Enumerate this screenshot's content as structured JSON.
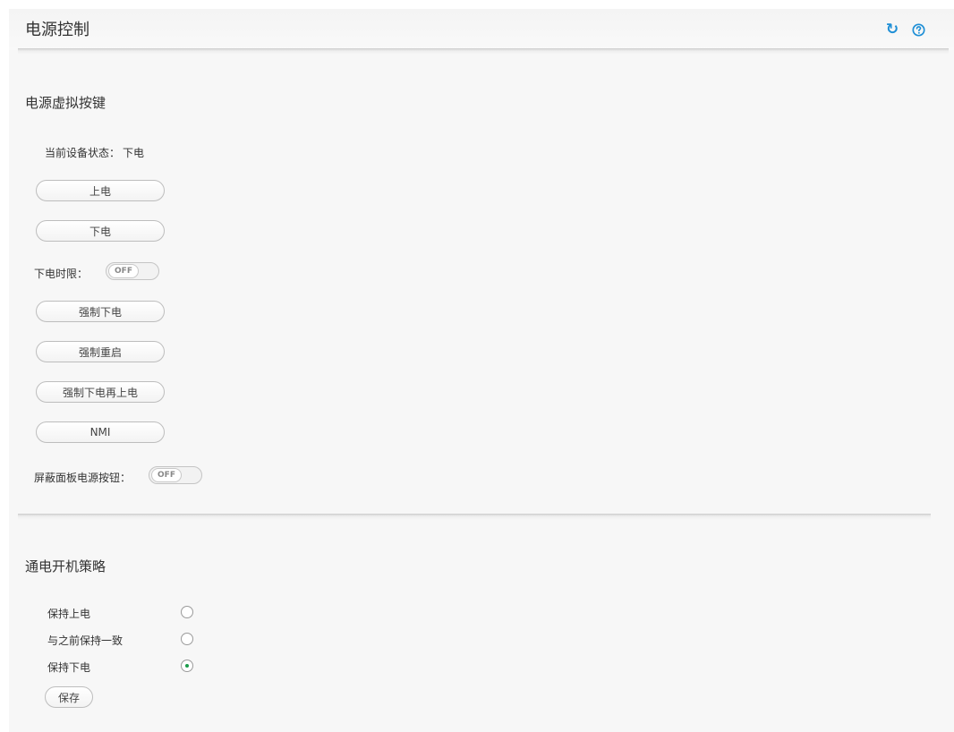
{
  "page": {
    "title": "电源控制"
  },
  "header_icons": {
    "refresh": "refresh-icon",
    "help": "help-icon",
    "accent": "#1f8fd6"
  },
  "power_keys": {
    "title": "电源虚拟按键",
    "status_label": "当前设备状态：",
    "status_value": "下电",
    "btn_power_on": "上电",
    "btn_power_off": "下电",
    "timeout_label": "下电时限：",
    "timeout_toggle": "OFF",
    "btn_force_off": "强制下电",
    "btn_force_restart": "强制重启",
    "btn_force_cycle": "强制下电再上电",
    "btn_nmi": "NMI",
    "panel_button_label": "屏蔽面板电源按钮：",
    "panel_button_toggle": "OFF"
  },
  "policy": {
    "title": "通电开机策略",
    "options": [
      {
        "label": "保持上电",
        "selected": false
      },
      {
        "label": "与之前保持一致",
        "selected": false
      },
      {
        "label": "保持下电",
        "selected": true
      }
    ],
    "save_label": "保存",
    "selected_color": "#1a9c4a"
  }
}
